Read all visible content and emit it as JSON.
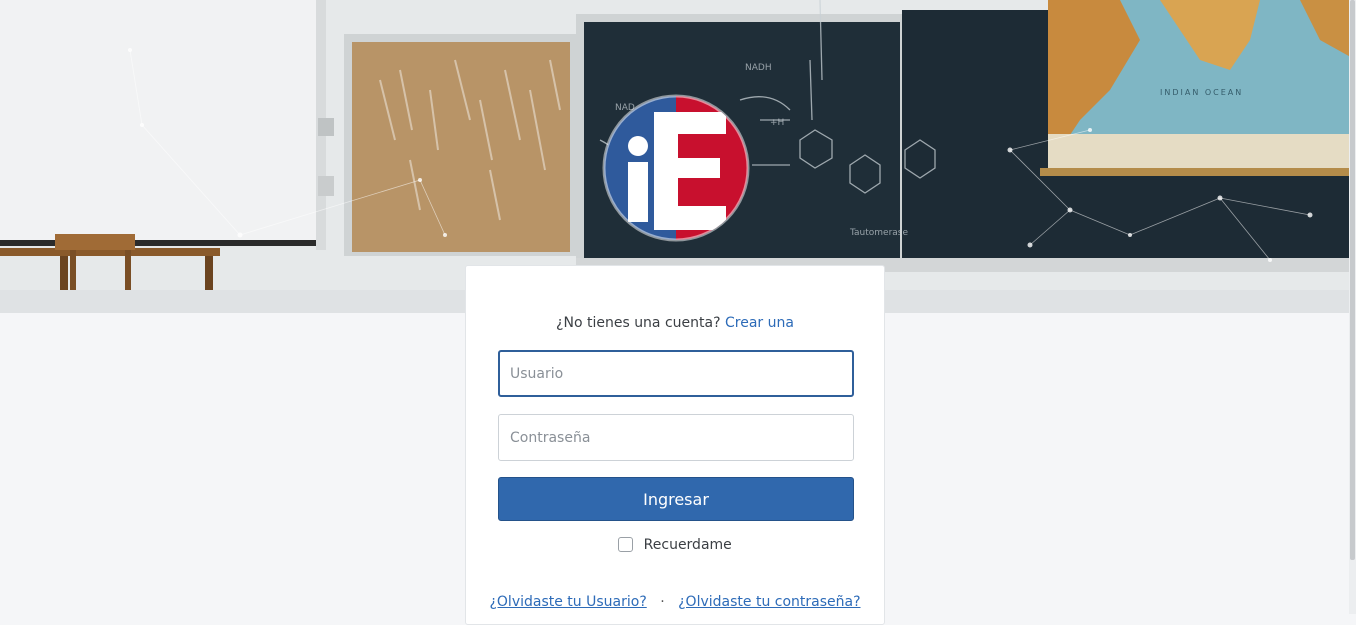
{
  "brand": {
    "logo_text": "iE",
    "logo_colors": {
      "blue": "#2f5a9c",
      "red": "#c8102e",
      "white": "#ffffff"
    }
  },
  "signup": {
    "prompt": "¿No tienes una cuenta?",
    "link": "Crear una"
  },
  "form": {
    "username_placeholder": "Usuario",
    "username_value": "",
    "password_placeholder": "Contraseña",
    "password_value": "",
    "submit_label": "Ingresar",
    "remember_label": "Recuerdame",
    "remember_checked": false
  },
  "help_links": {
    "forgot_user": "¿Olvidaste tu Usuario?",
    "separator": "·",
    "forgot_password": "¿Olvidaste tu contraseña?"
  },
  "icons": {
    "checkbox": "checkbox-empty-icon"
  },
  "colors": {
    "accent": "#3068ad",
    "link": "#2d6bb8",
    "page_bg": "#f5f6f8"
  }
}
